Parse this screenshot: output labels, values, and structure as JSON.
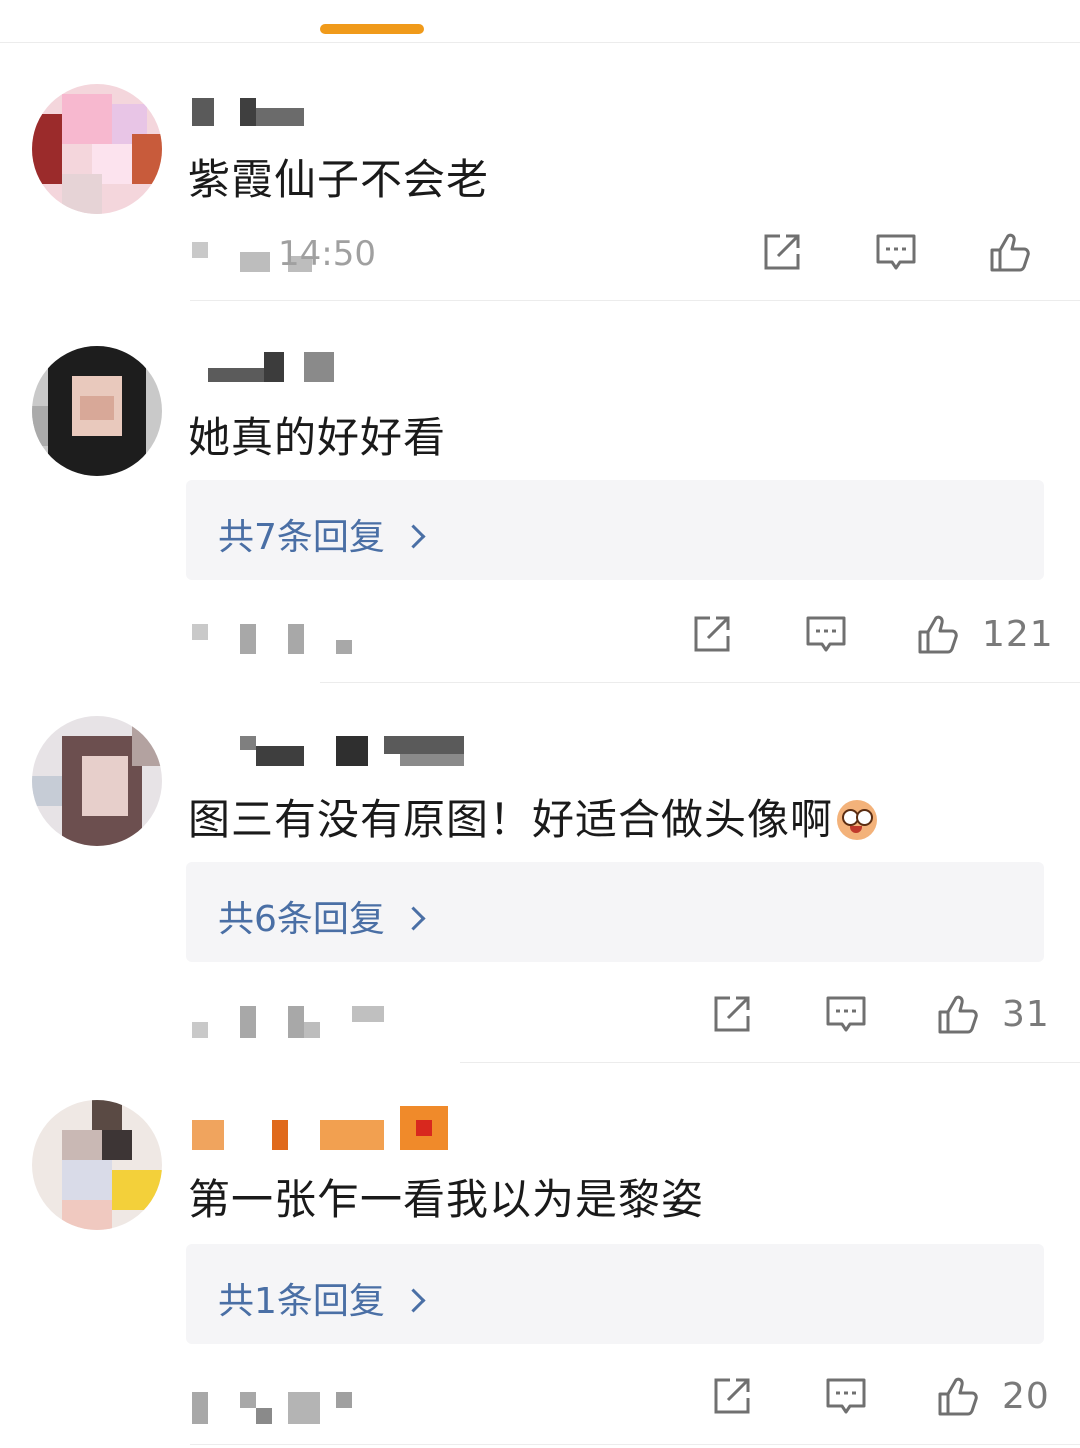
{
  "comments": [
    {
      "text": "紫霞仙子不会老",
      "time_partial": "14:50",
      "reply_label": "",
      "likes": ""
    },
    {
      "text": "她真的好好看",
      "reply_label": "共7条回复",
      "likes": "121"
    },
    {
      "text": "图三有没有原图！好适合做头像啊",
      "emoji": "face-emoji",
      "reply_label": "共6条回复",
      "likes": "31"
    },
    {
      "text": "第一张乍一看我以为是黎姿",
      "reply_label": "共1条回复",
      "likes": "20"
    }
  ],
  "icons": {
    "repost": "share-icon",
    "comment": "comment-icon",
    "like": "thumbs-up-icon"
  },
  "colors": {
    "accent": "#f09a1a",
    "reply_link": "#4a6fa5",
    "text": "#1a1a1a"
  }
}
